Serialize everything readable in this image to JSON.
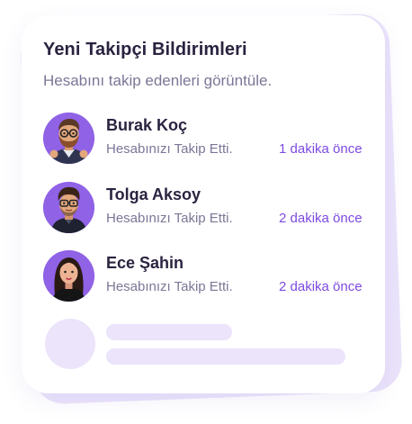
{
  "card": {
    "title": "Yeni Takipçi Bildirimleri",
    "subtitle": "Hesabını takip edenleri görüntüle."
  },
  "notifications": [
    {
      "name": "Burak Koç",
      "action": "Hesabınızı Takip Etti.",
      "time": "1 dakika önce",
      "avatar": "avatar-man-beard-glasses"
    },
    {
      "name": "Tolga Aksoy",
      "action": "Hesabınızı Takip Etti.",
      "time": "2 dakika önce",
      "avatar": "avatar-man-glasses"
    },
    {
      "name": "Ece Şahin",
      "action": "Hesabınızı Takip Etti.",
      "time": "2 dakika önce",
      "avatar": "avatar-woman"
    }
  ],
  "colors": {
    "accent": "#7d4be0",
    "avatar_bg": "#8f62e6",
    "skeleton": "#ebe4fb",
    "text_dark": "#2b2340",
    "text_muted": "#7c7697"
  }
}
